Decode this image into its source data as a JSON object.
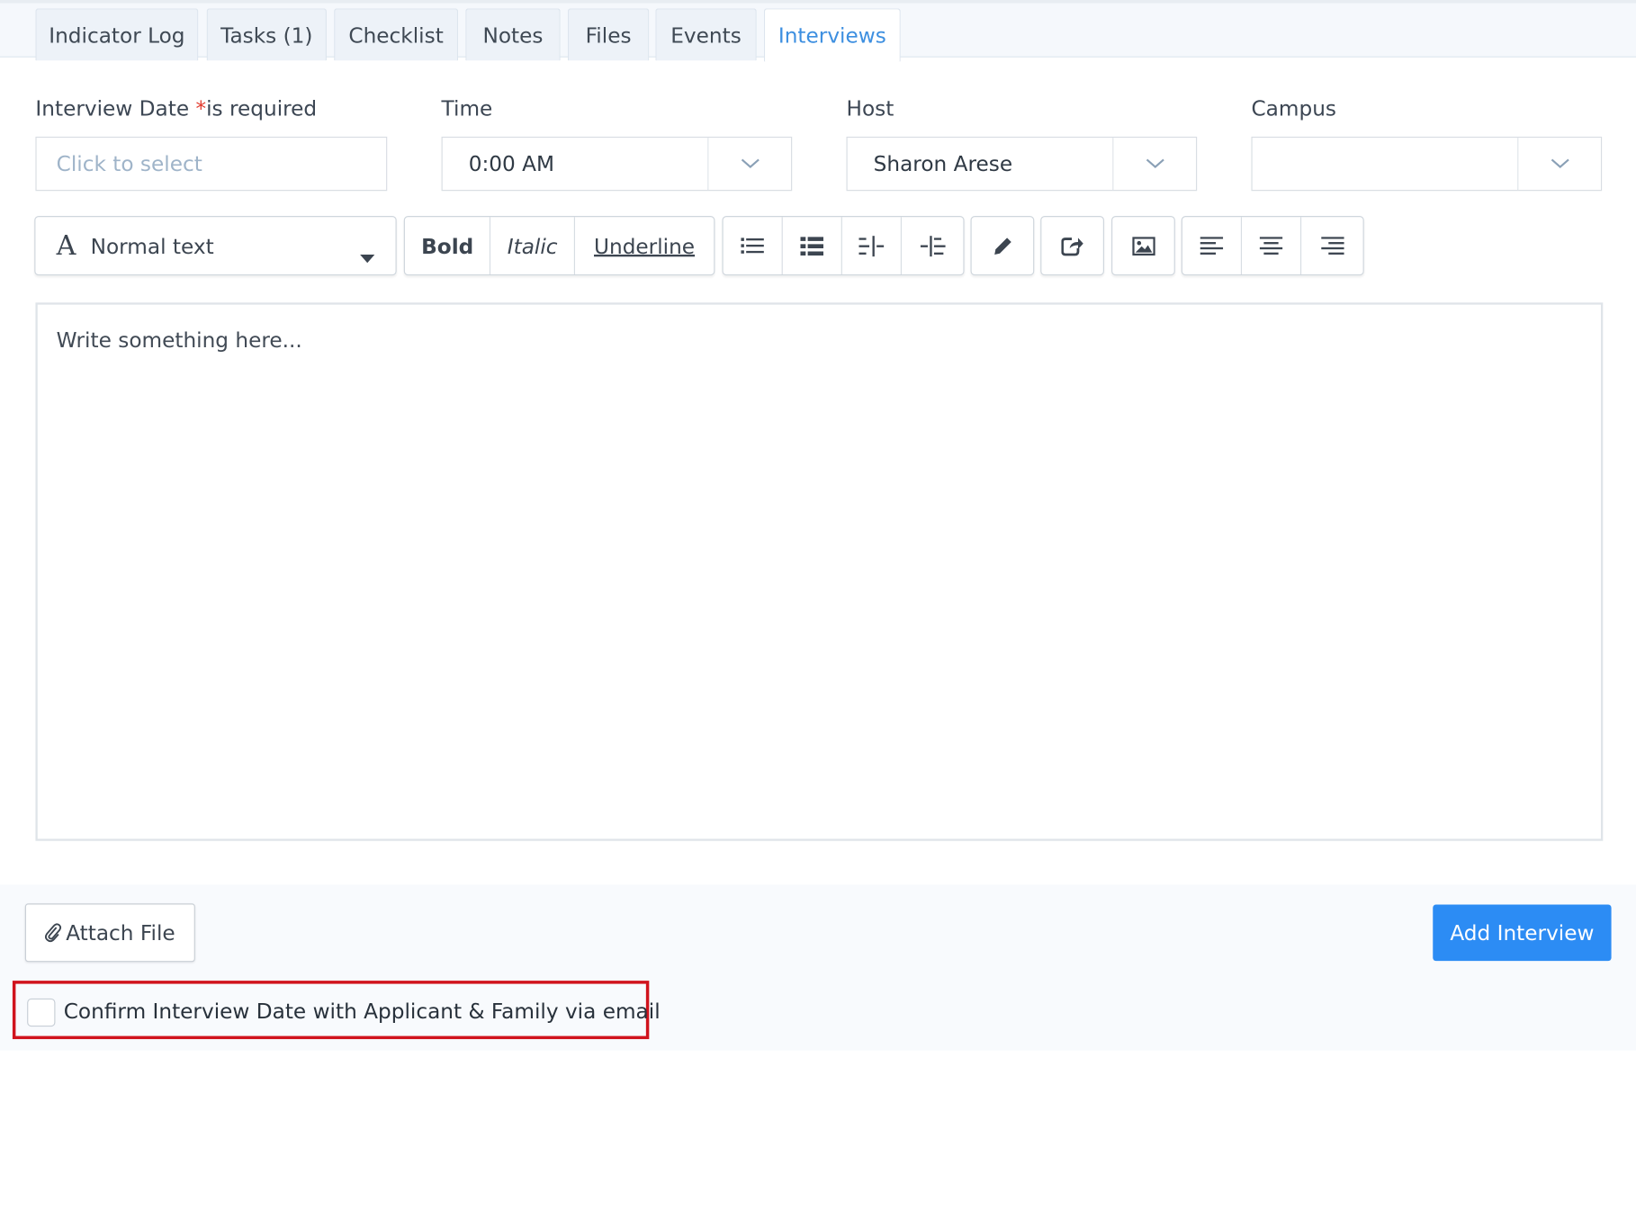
{
  "tabs": [
    {
      "label": "Indicator Log"
    },
    {
      "label": "Tasks (1)"
    },
    {
      "label": "Checklist"
    },
    {
      "label": "Notes"
    },
    {
      "label": "Files"
    },
    {
      "label": "Events"
    },
    {
      "label": "Interviews",
      "active": true
    }
  ],
  "form": {
    "interview_date_label": "Interview Date",
    "required_star": "*",
    "required_text": "is required",
    "interview_date_placeholder": "Click to select",
    "time_label": "Time",
    "time_value": "0:00 AM",
    "host_label": "Host",
    "host_value": "Sharon Arese",
    "campus_label": "Campus",
    "campus_value": ""
  },
  "toolbar": {
    "block_style": "Normal text",
    "bold": "Bold",
    "italic": "Italic",
    "underline": "Underline",
    "icons": [
      "unordered-list-icon",
      "ordered-list-icon",
      "outdent-icon",
      "indent-icon",
      "pencil-icon",
      "share-icon",
      "image-icon",
      "align-left-icon",
      "align-center-icon",
      "align-right-icon"
    ]
  },
  "editor": {
    "placeholder": "Write something here..."
  },
  "footer": {
    "attach_label": "Attach File",
    "add_interview_label": "Add Interview",
    "confirm_label": "Confirm Interview Date with Applicant & Family via email",
    "confirm_checked": false
  },
  "colors": {
    "accent": "#3d8fe0",
    "primary_button": "#2c8cf4",
    "highlight_border": "#d0131d",
    "required": "#e23b2e"
  }
}
